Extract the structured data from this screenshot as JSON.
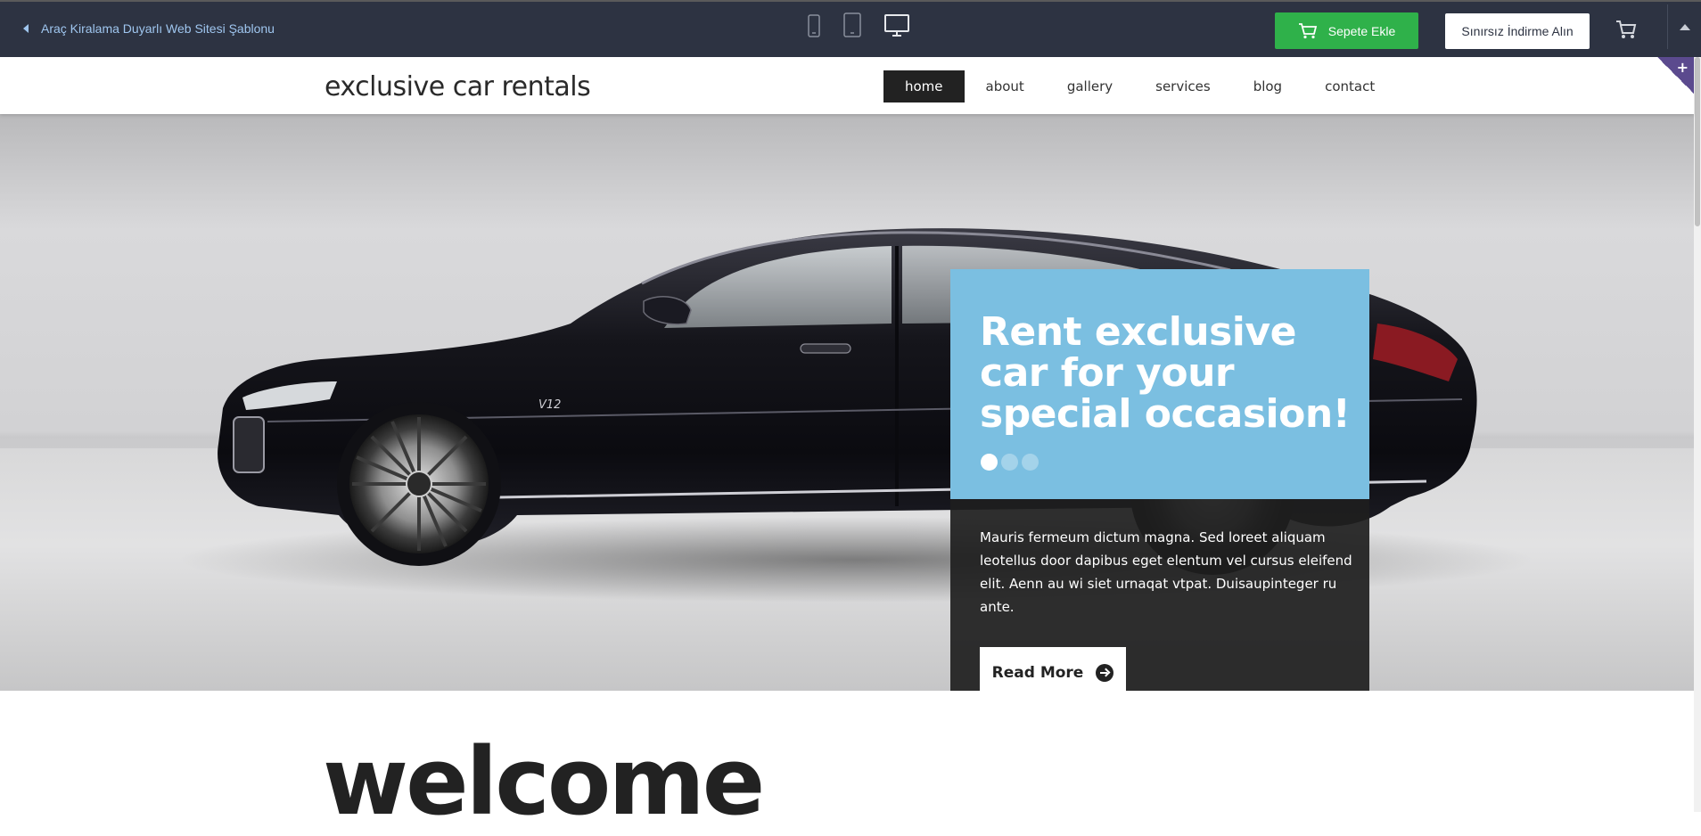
{
  "toolbar": {
    "back_label": "Araç Kiralama Duyarlı Web Sitesi Şablonu",
    "devices": [
      "mobile-icon",
      "tablet-icon",
      "desktop-icon"
    ],
    "add_to_cart_label": "Sepete Ekle",
    "download_label": "Sınırsız İndirme Alın",
    "colors": {
      "bar": "#2d3342",
      "link": "#9fc6ef",
      "green": "#2fb14a"
    }
  },
  "site": {
    "logo": "exclusive car rentals",
    "nav": [
      {
        "label": "home",
        "active": true
      },
      {
        "label": "about",
        "active": false
      },
      {
        "label": "gallery",
        "active": false
      },
      {
        "label": "services",
        "active": false
      },
      {
        "label": "blog",
        "active": false
      },
      {
        "label": "contact",
        "active": false
      }
    ]
  },
  "hero": {
    "title": "Rent exclusive car for your special occasion!",
    "slides": {
      "count": 3,
      "active": 1
    },
    "body": "Mauris fermeum dictum magna. Sed loreet aliquam leotellus door dapibus eget elentum vel cursus eleifend elit. Aenn au wi siet urnaqat vtpat. Duisaupinteger ru ante.",
    "button_label": "Read More",
    "badge": "V12",
    "colors": {
      "promo_blue": "#7bbfe1",
      "promo_dark": "#1e1e1e"
    }
  },
  "welcome": {
    "heading": "welcome"
  }
}
